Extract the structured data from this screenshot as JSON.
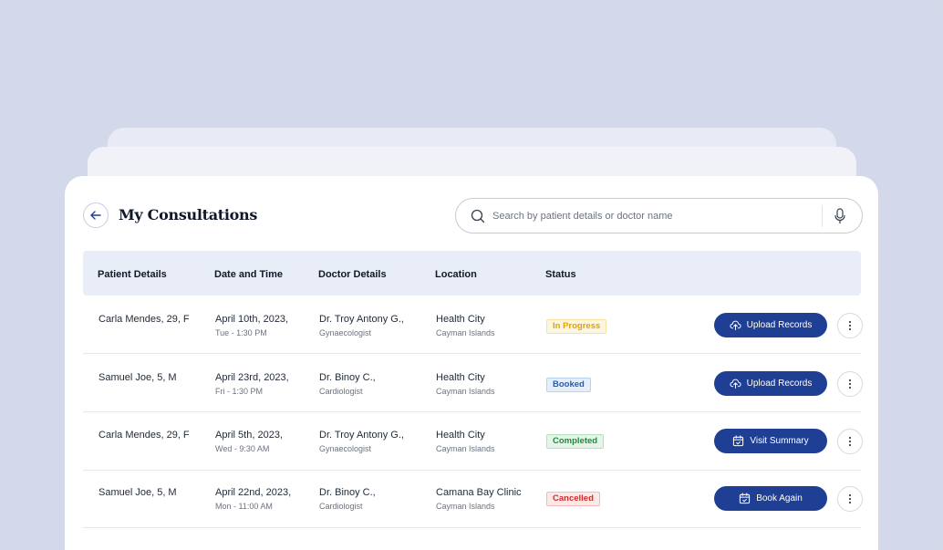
{
  "header": {
    "title": "My Consultations",
    "back_icon": "arrow-left-icon"
  },
  "search": {
    "placeholder": "Search by patient details or doctor name",
    "value": "",
    "icon": "search-icon",
    "mic_icon": "microphone-icon"
  },
  "table": {
    "columns": [
      "Patient Details",
      "Date and Time",
      "Doctor Details",
      "Location",
      "Status"
    ],
    "rows": [
      {
        "patient": "Carla Mendes, 29, F",
        "date": "April 10th, 2023,",
        "time": "Tue - 1:30 PM",
        "doctor": "Dr. Troy Antony G.,",
        "specialty": "Gynaecologist",
        "location": "Health City",
        "region": "Cayman Islands",
        "status": "In Progress",
        "action": "Upload Records",
        "action_icon": "upload-icon"
      },
      {
        "patient": "Samuel Joe, 5, M",
        "date": "April 23rd, 2023,",
        "time": "Fri - 1:30 PM",
        "doctor": "Dr. Binoy C.,",
        "specialty": "Cardiologist",
        "location": "Health City",
        "region": "Cayman Islands",
        "status": "Booked",
        "action": "Upload Records",
        "action_icon": "upload-icon"
      },
      {
        "patient": "Carla Mendes, 29, F",
        "date": "April 5th, 2023,",
        "time": "Wed - 9:30 AM",
        "doctor": "Dr. Troy Antony G.,",
        "specialty": "Gynaecologist",
        "location": "Health City",
        "region": "Cayman Islands",
        "status": "Completed",
        "action": "Visit Summary",
        "action_icon": "calendar-check-icon"
      },
      {
        "patient": "Samuel Joe, 5, M",
        "date": "April 22nd, 2023,",
        "time": "Mon - 11:00 AM",
        "doctor": "Dr. Binoy C.,",
        "specialty": "Cardiologist",
        "location": "Camana Bay Clinic",
        "region": "Cayman Islands",
        "status": "Cancelled",
        "action": "Book Again",
        "action_icon": "calendar-check-icon"
      }
    ]
  },
  "colors": {
    "page_bg": "#d4d9ea",
    "primary_button": "#1e3f93",
    "table_header_bg": "#e9edf7",
    "status_in_progress": "#e5a100",
    "status_booked": "#1d5fbf",
    "status_completed": "#1e8c3a",
    "status_cancelled": "#d62828"
  }
}
